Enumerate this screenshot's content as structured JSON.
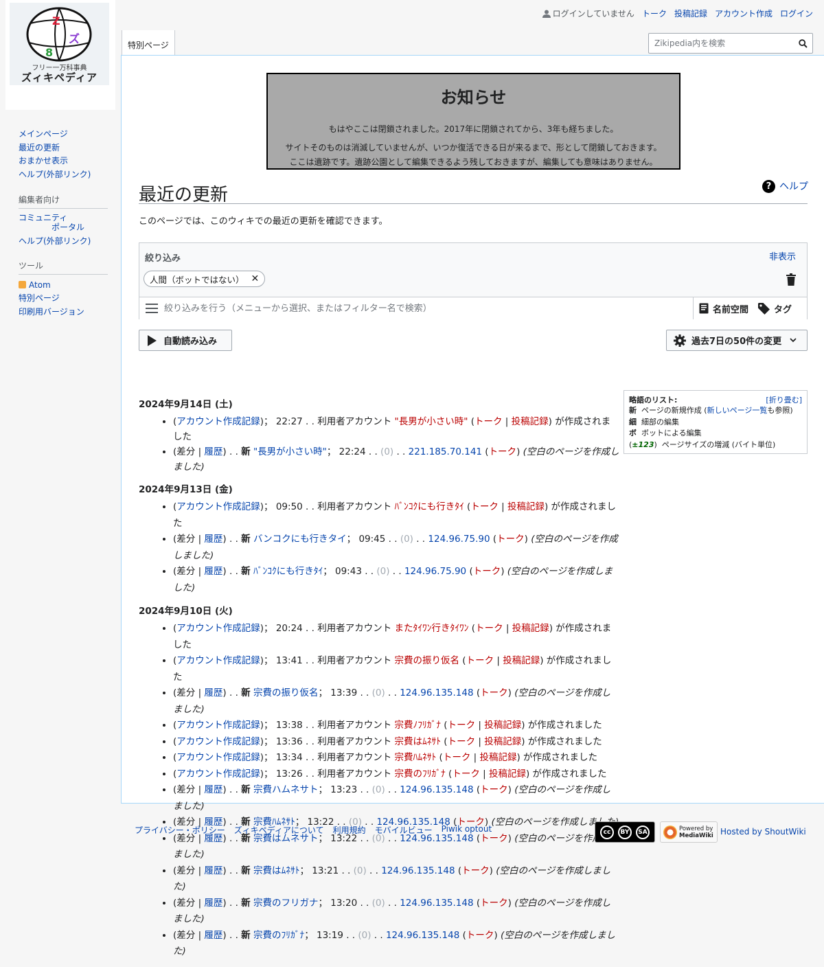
{
  "logo": {
    "line1": "フリー一万科事典",
    "line2": "ズィキペディア"
  },
  "nav": {
    "main": [
      "メインページ",
      "最近の更新",
      "おまかせ表示",
      "ヘルプ(外部リンク)"
    ],
    "editors_heading": "編集者向け",
    "editors": {
      "community_1": "コミュニティ",
      "community_2": "ポータル",
      "help": "ヘルプ(外部リンク)"
    },
    "tools_heading": "ツール",
    "tools": [
      "Atom",
      "特別ページ",
      "印刷用バージョン"
    ]
  },
  "personal": {
    "not_logged_in": "ログインしていません",
    "talk": "トーク",
    "contribs": "投稿記録",
    "create_account": "アカウント作成",
    "login": "ログイン"
  },
  "tab": "特別ページ",
  "search": {
    "placeholder": "Zikipedia内を検索"
  },
  "notice": {
    "title": "お知らせ",
    "p1": "もはやここは閉鎖されました。2017年に閉鎖されてから、3年も経ちました。",
    "p2": "サイトそのものは消滅していませんが、いつか復活できる日が来るまで、形として閉鎖しておきます。",
    "p3": "ここは遺跡です。遺跡公園として編集できるよう残しておきますが、編集しても意味はありません。"
  },
  "heading": "最近の更新",
  "help_link": "ヘルプ",
  "intro": "このページでは、このウィキでの最近の更新を確認できます。",
  "filters": {
    "label": "絞り込み",
    "hide": "非表示",
    "chip": "人間（ボットではない）",
    "chip_x": "✕",
    "placeholder": "絞り込みを行う（メニューから選択、またはフィルター名で検索）",
    "namespace": "名前空間",
    "tags": "タグ"
  },
  "live_button": "自動読み込み",
  "limit_button": "過去7日の50件の変更",
  "legend": {
    "title": "略語のリスト:",
    "collapse": "[折り畳む]",
    "new_abbr": "新",
    "new_text": "ページの新規作成 (",
    "new_link": "新しいページ一覧",
    "new_tail": "も参照)",
    "minor_abbr": "細",
    "minor_text": "細部の編集",
    "bot_abbr": "ボ",
    "bot_text": "ボットによる編集",
    "size_abbr": "±123",
    "size_text": "ページサイズの増減 (バイト単位)"
  },
  "days": [
    {
      "date": "2024年9月14日 (土)",
      "entries": [
        {
          "kind": "newuser",
          "log": "アカウント作成記録",
          "time": "22:27",
          "text": "利用者アカウント",
          "user": "\"長男が小さい時\"",
          "talk": "トーク",
          "contribs": "投稿記録",
          "tail": "が作成されました"
        },
        {
          "kind": "page",
          "diff": "差分",
          "hist": "履歴",
          "flag": "新",
          "title": "\"長男が小さい時\"",
          "time": "22:24",
          "size": "(0)",
          "user": "221.185.70.141",
          "talk": "トーク",
          "summary": "(空白のページを作成しました)"
        }
      ]
    },
    {
      "date": "2024年9月13日 (金)",
      "entries": [
        {
          "kind": "newuser",
          "log": "アカウント作成記録",
          "time": "09:50",
          "text": "利用者アカウント",
          "user": "ﾊﾞﾝｺｸにも行きﾀｲ",
          "talk": "トーク",
          "contribs": "投稿記録",
          "tail": "が作成されました"
        },
        {
          "kind": "page",
          "diff": "差分",
          "hist": "履歴",
          "flag": "新",
          "title": "バンコクにも行きタイ",
          "time": "09:45",
          "size": "(0)",
          "user": "124.96.75.90",
          "talk": "トーク",
          "summary": "(空白のページを作成しました)"
        },
        {
          "kind": "page",
          "diff": "差分",
          "hist": "履歴",
          "flag": "新",
          "title": "ﾊﾞﾝｺｸにも行きﾀｲ",
          "time": "09:43",
          "size": "(0)",
          "user": "124.96.75.90",
          "talk": "トーク",
          "summary": "(空白のページを作成しました)"
        }
      ]
    },
    {
      "date": "2024年9月10日 (火)",
      "entries": [
        {
          "kind": "newuser",
          "log": "アカウント作成記録",
          "time": "20:24",
          "text": "利用者アカウント",
          "user": "またﾀｲﾜﾝ行きﾀｲﾜﾝ",
          "talk": "トーク",
          "contribs": "投稿記録",
          "tail": "が作成されました"
        },
        {
          "kind": "newuser",
          "log": "アカウント作成記録",
          "time": "13:41",
          "text": "利用者アカウント",
          "user": "宗費の振り仮名",
          "talk": "トーク",
          "contribs": "投稿記録",
          "tail": "が作成されました"
        },
        {
          "kind": "page",
          "diff": "差分",
          "hist": "履歴",
          "flag": "新",
          "title": "宗費の振り仮名",
          "time": "13:39",
          "size": "(0)",
          "user": "124.96.135.148",
          "talk": "トーク",
          "summary": "(空白のページを作成しました)"
        },
        {
          "kind": "newuser",
          "log": "アカウント作成記録",
          "time": "13:38",
          "text": "利用者アカウント",
          "user": "宗費ﾉﾌﾘｶﾞﾅ",
          "talk": "トーク",
          "contribs": "投稿記録",
          "tail": "が作成されました"
        },
        {
          "kind": "newuser",
          "log": "アカウント作成記録",
          "time": "13:36",
          "text": "利用者アカウント",
          "user": "宗費はﾑﾈｻﾄ",
          "talk": "トーク",
          "contribs": "投稿記録",
          "tail": "が作成されました"
        },
        {
          "kind": "newuser",
          "log": "アカウント作成記録",
          "time": "13:34",
          "text": "利用者アカウント",
          "user": "宗費ﾊﾑﾈｻﾄ",
          "talk": "トーク",
          "contribs": "投稿記録",
          "tail": "が作成されました"
        },
        {
          "kind": "newuser",
          "log": "アカウント作成記録",
          "time": "13:26",
          "text": "利用者アカウント",
          "user": "宗費のﾌﾘｶﾞﾅ",
          "talk": "トーク",
          "contribs": "投稿記録",
          "tail": "が作成されました"
        },
        {
          "kind": "page",
          "diff": "差分",
          "hist": "履歴",
          "flag": "新",
          "title": "宗費ハムネサト",
          "time": "13:23",
          "size": "(0)",
          "user": "124.96.135.148",
          "talk": "トーク",
          "summary": "(空白のページを作成しました)"
        },
        {
          "kind": "page",
          "diff": "差分",
          "hist": "履歴",
          "flag": "新",
          "title": "宗費ﾊﾑﾈｻﾄ",
          "time": "13:22",
          "size": "(0)",
          "user": "124.96.135.148",
          "talk": "トーク",
          "summary": "(空白のページを作成しました)"
        },
        {
          "kind": "page",
          "diff": "差分",
          "hist": "履歴",
          "flag": "新",
          "title": "宗費はムネサト",
          "time": "13:22",
          "size": "(0)",
          "user": "124.96.135.148",
          "talk": "トーク",
          "summary": "(空白のページを作成しました)"
        },
        {
          "kind": "page",
          "diff": "差分",
          "hist": "履歴",
          "flag": "新",
          "title": "宗費はﾑﾈｻﾄ",
          "time": "13:21",
          "size": "(0)",
          "user": "124.96.135.148",
          "talk": "トーク",
          "summary": "(空白のページを作成しました)"
        },
        {
          "kind": "page",
          "diff": "差分",
          "hist": "履歴",
          "flag": "新",
          "title": "宗費のフリガナ",
          "time": "13:20",
          "size": "(0)",
          "user": "124.96.135.148",
          "talk": "トーク",
          "summary": "(空白のページを作成しました)"
        },
        {
          "kind": "page",
          "diff": "差分",
          "hist": "履歴",
          "flag": "新",
          "title": "宗費のﾌﾘｶﾞﾅ",
          "time": "13:19",
          "size": "(0)",
          "user": "124.96.135.148",
          "talk": "トーク",
          "summary": "(空白のページを作成しました)"
        }
      ]
    }
  ],
  "footer": {
    "links": [
      "プライバシー・ポリシー",
      "ズィキペディアについて",
      "利用規約",
      "モバイルビュー",
      "Piwik optout"
    ]
  },
  "badges": {
    "cc": [
      "cc",
      "BY",
      "SA"
    ],
    "mw_1": "Powered by",
    "mw_2": "MediaWiki",
    "shout": "Hosted by ShoutWiki"
  },
  "colors": {
    "link": "#0645ad",
    "redlink": "#ba0000",
    "notice_bg": "#a9a9a9"
  }
}
